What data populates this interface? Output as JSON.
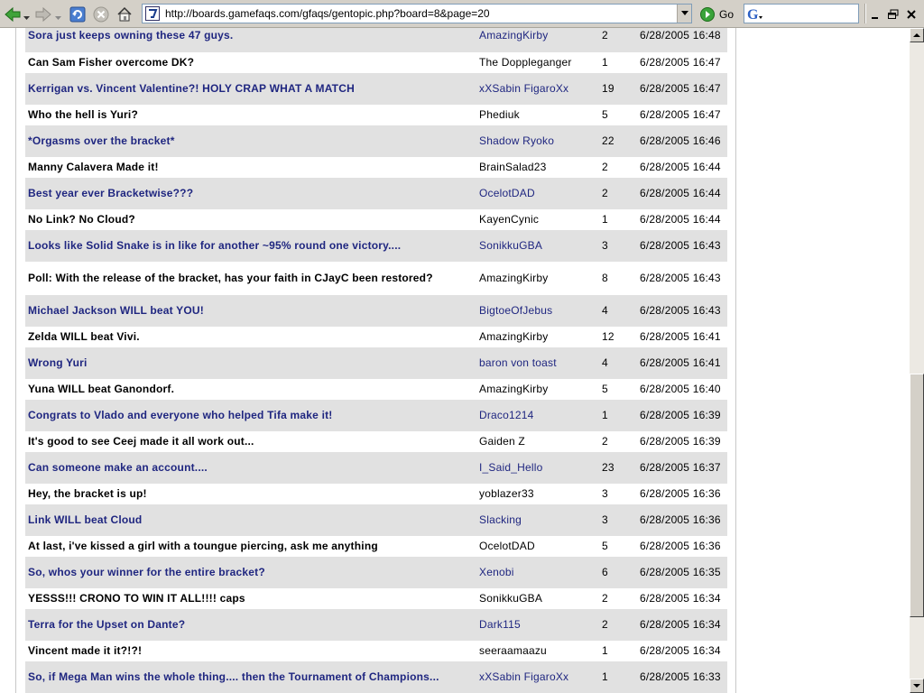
{
  "browser": {
    "url": "http://boards.gamefaqs.com/gfaqs/gentopic.php?board=8&page=20",
    "go_label": "Go",
    "search_value": ""
  },
  "topics": [
    {
      "title": "Sora just keeps owning these 47 guys.",
      "author": "AmazingKirby",
      "posts": "2",
      "date": "6/28/2005 16:48"
    },
    {
      "title": "Can Sam Fisher overcome DK?",
      "author": "The Doppleganger",
      "posts": "1",
      "date": "6/28/2005 16:47"
    },
    {
      "title": "Kerrigan vs. Vincent Valentine?! HOLY CRAP WHAT A MATCH",
      "author": "xXSabin FigaroXx",
      "posts": "19",
      "date": "6/28/2005 16:47"
    },
    {
      "title": "Who the hell is Yuri?",
      "author": "Phediuk",
      "posts": "5",
      "date": "6/28/2005 16:47"
    },
    {
      "title": "*Orgasms over the bracket*",
      "author": "Shadow Ryoko",
      "posts": "22",
      "date": "6/28/2005 16:46"
    },
    {
      "title": "Manny Calavera Made it!",
      "author": "BrainSalad23",
      "posts": "2",
      "date": "6/28/2005 16:44"
    },
    {
      "title": "Best year ever Bracketwise???",
      "author": "OcelotDAD",
      "posts": "2",
      "date": "6/28/2005 16:44"
    },
    {
      "title": "No Link? No Cloud?",
      "author": "KayenCynic",
      "posts": "1",
      "date": "6/28/2005 16:44"
    },
    {
      "title": "Looks like Solid Snake is in like for another ~95% round one victory....",
      "author": "SonikkuGBA",
      "posts": "3",
      "date": "6/28/2005 16:43"
    },
    {
      "title": "Poll: With the release of the bracket, has your faith in CJayC been restored?",
      "author": "AmazingKirby",
      "posts": "8",
      "date": "6/28/2005 16:43"
    },
    {
      "title": "Michael Jackson WILL beat YOU!",
      "author": "BigtoeOfJebus",
      "posts": "4",
      "date": "6/28/2005 16:43"
    },
    {
      "title": "Zelda WILL beat Vivi.",
      "author": "AmazingKirby",
      "posts": "12",
      "date": "6/28/2005 16:41"
    },
    {
      "title": "Wrong Yuri",
      "author": "baron von toast",
      "posts": "4",
      "date": "6/28/2005 16:41"
    },
    {
      "title": "Yuna WILL beat Ganondorf.",
      "author": "AmazingKirby",
      "posts": "5",
      "date": "6/28/2005 16:40"
    },
    {
      "title": "Congrats to Vlado and everyone who helped Tifa make it!",
      "author": "Draco1214",
      "posts": "1",
      "date": "6/28/2005 16:39"
    },
    {
      "title": "It's good to see Ceej made it all work out...",
      "author": "Gaiden Z",
      "posts": "2",
      "date": "6/28/2005 16:39"
    },
    {
      "title": "Can someone make an account....",
      "author": "I_Said_Hello",
      "posts": "23",
      "date": "6/28/2005 16:37"
    },
    {
      "title": "Hey, the bracket is up!",
      "author": "yoblazer33",
      "posts": "3",
      "date": "6/28/2005 16:36"
    },
    {
      "title": "Link WILL beat Cloud",
      "author": "Slacking",
      "posts": "3",
      "date": "6/28/2005 16:36"
    },
    {
      "title": "At last, i've kissed a girl with a toungue piercing, ask me anything",
      "author": "OcelotDAD",
      "posts": "5",
      "date": "6/28/2005 16:36"
    },
    {
      "title": "So, whos your winner for the entire bracket?",
      "author": "Xenobi",
      "posts": "6",
      "date": "6/28/2005 16:35"
    },
    {
      "title": "YESSS!!! CRONO TO WIN IT ALL!!!! caps",
      "author": "SonikkuGBA",
      "posts": "2",
      "date": "6/28/2005 16:34"
    },
    {
      "title": "Terra for the Upset on Dante?",
      "author": "Dark115",
      "posts": "2",
      "date": "6/28/2005 16:34"
    },
    {
      "title": "Vincent made it it?!?!",
      "author": "seeraamaazu",
      "posts": "1",
      "date": "6/28/2005 16:34"
    },
    {
      "title": "So, if Mega Man wins the whole thing.... then the Tournament of Champions...",
      "author": "xXSabin FigaroXx",
      "posts": "1",
      "date": "6/28/2005 16:33"
    }
  ]
}
